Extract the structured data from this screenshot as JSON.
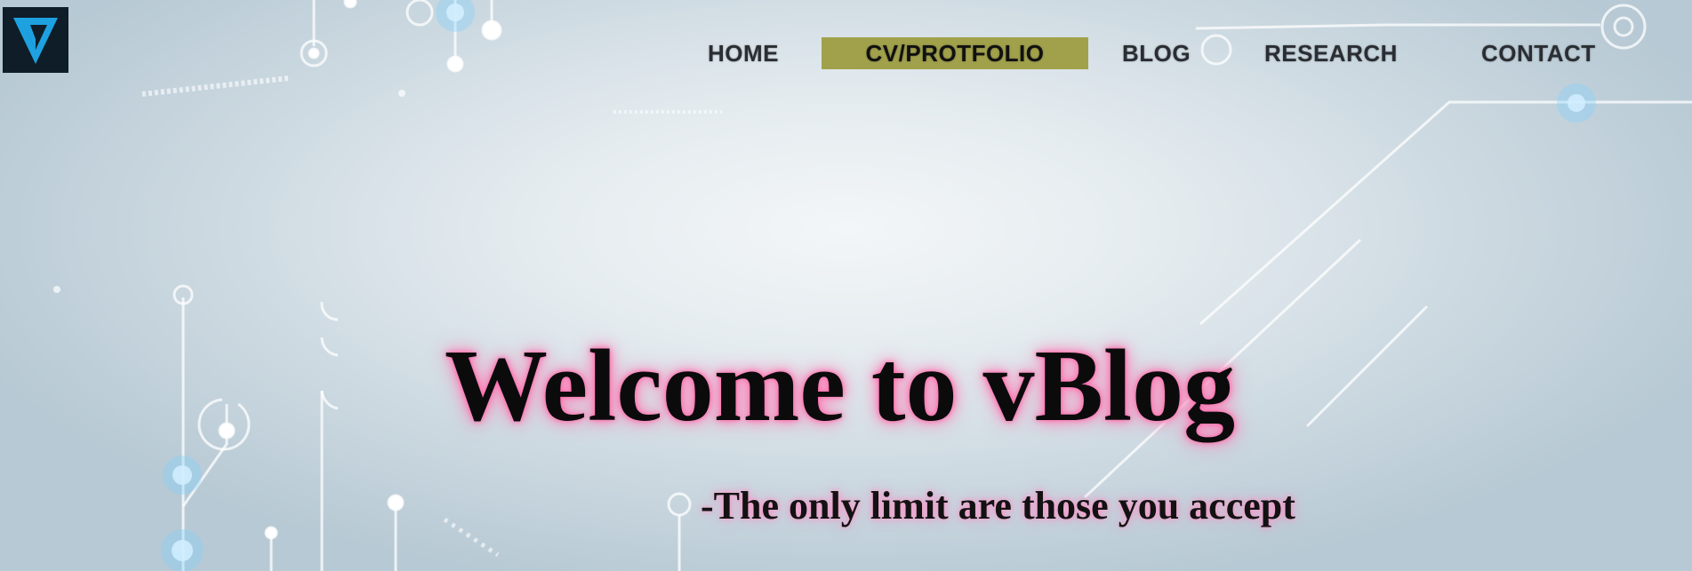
{
  "nav": {
    "items": [
      {
        "label": "HOME"
      },
      {
        "label": "CV/PROTFOLIO",
        "active": true
      },
      {
        "label": "BLOG"
      },
      {
        "label": "RESEARCH"
      },
      {
        "label": "CONTACT"
      }
    ],
    "active_color": "#a1a14c"
  },
  "hero": {
    "title": "Welcome to vBlog",
    "subtitle": "-The only limit are those you accept",
    "glow_color": "#ff7fb6"
  },
  "logo": {
    "icon": "v-logo-icon",
    "background_color": "#0f1d28",
    "accent_color": "#1ea1e0"
  }
}
